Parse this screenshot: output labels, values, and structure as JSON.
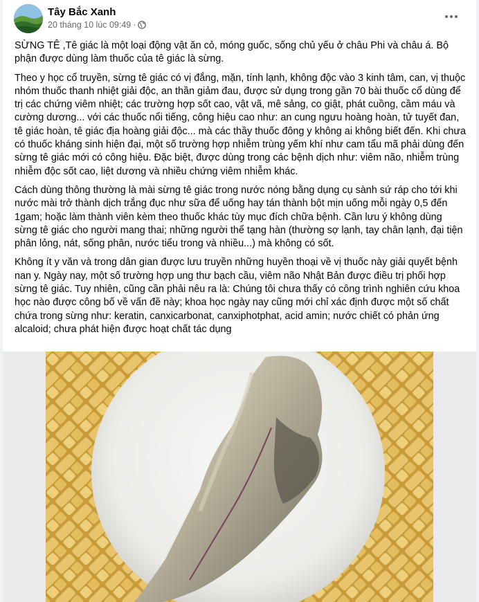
{
  "post": {
    "author": "Tây Bắc Xanh",
    "timestamp": "20 tháng 10 lúc 09:49",
    "separator": "·",
    "privacy_icon": "globe-icon",
    "more_icon": "more-options-icon",
    "paragraphs": [
      "SỪNG TÊ ,Tê giác là một loại động vật ăn cỏ, móng guốc, sống chủ yếu ở châu Phi và châu á. Bộ phận được dùng làm thuốc của tê giác là sừng.",
      "Theo y học cổ truyền, sừng tê giác có vị đắng, mặn, tính lạnh, không độc vào 3 kinh tâm, can, vị thuộc nhóm thuốc thanh nhiệt giải độc, an thần giảm đau, được sử dụng trong gần 70 bài thuốc cổ dùng để trị các chứng viêm nhiệt; các trường hợp sốt cao, vật vã, mê sảng, co giật, phát cuồng, cầm máu và cường dương... với các thuốc nổi tiếng, công hiệu cao như: an cung ngưu hoàng hoàn, tử tuyết đan, tê giác hoàn, tê giác địa hoàng giải độc... mà các thầy thuốc đông y không ai không biết đến. Khi chưa có thuốc kháng sinh hiện đại, một số trường hợp nhiễm trùng yếm khí như cam tẩu mã phải dùng đến sừng tê giác mới có công hiệu. Đặc biệt, được dùng trong các bệnh dịch như: viêm não, nhiễm trùng nhiễm độc sốt cao, liệt dương và nhiều chứng viêm nhiễm khác.",
      "Cách dùng thông thường là mài sừng tê giác trong nước nóng bằng dụng cụ sành sứ ráp cho tới khi nước mài trở thành dịch trắng đục như sữa để uống hay tán thành bột mịn uống mỗi ngày 0,5 đến 1gam; hoặc làm thành viên kèm theo thuốc khác tùy mục đích chữa bệnh. Cần lưu ý không dùng sừng tê giác cho người mang thai; những người thể tạng hàn (thường sợ lạnh, tay chân lạnh, đại tiện phân lỏng, nát, sống phân, nước tiểu trong và nhiều...) mà không có sốt.",
      "Không ít y văn và trong dân gian được lưu truyền những huyền thoại về vị thuốc này giải quyết bệnh nan y. Ngày nay, một số trường hợp ung thư bạch cầu, viêm não Nhật Bản được điều trị phối hợp sừng tê giác. Tuy nhiên, cũng cần phải nêu ra là: Chúng tôi chưa thấy có công trình nghiên cứu khoa học nào được công bố về vấn đề này; khoa học ngày nay cũng mới chỉ xác định được một số chất chứa trong sừng như: keratin, canxicarbonat, canxiphotphat, acid amin; nước chiết có phản ứng alcaloid; chưa phát hiện được hoạt chất tác dụng"
    ]
  }
}
